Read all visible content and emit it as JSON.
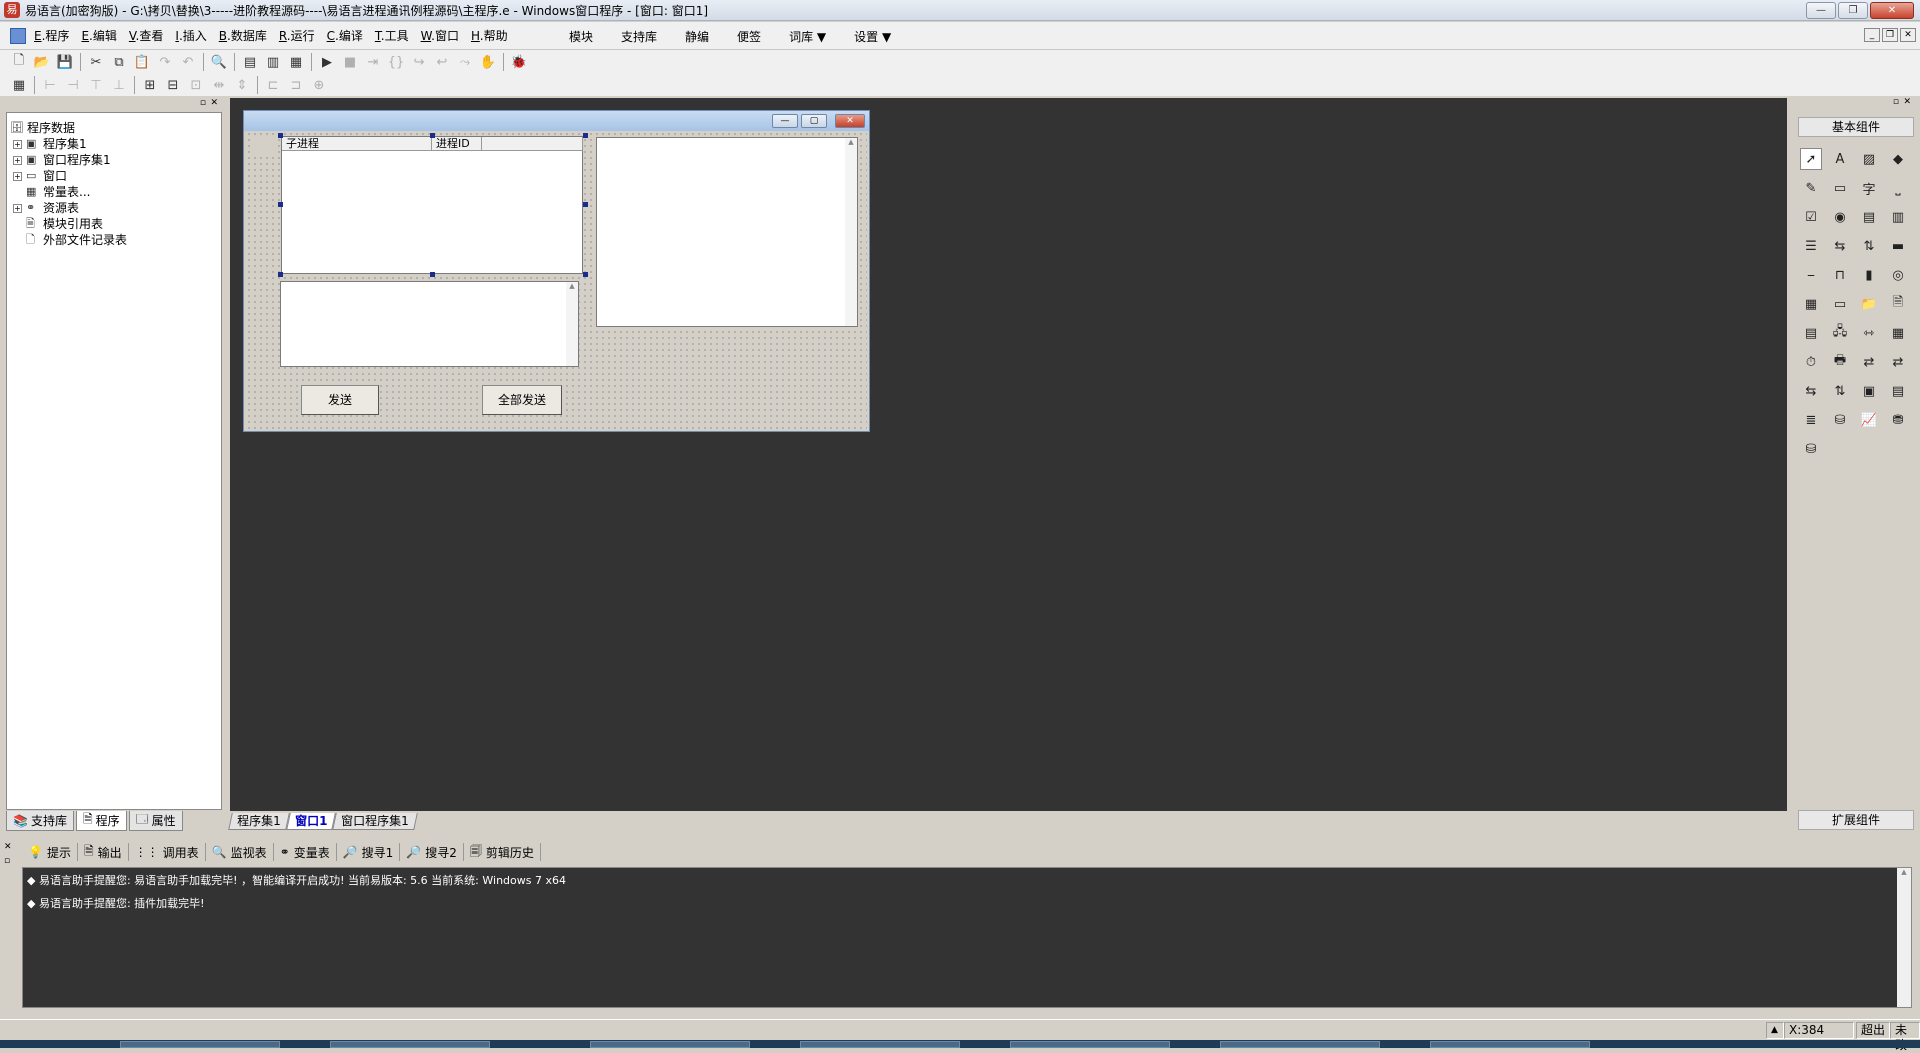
{
  "window": {
    "title": "易语言(加密狗版) - G:\\拷贝\\替换\\3-----进阶教程源码----\\易语言进程通讯例程源码\\主程序.e - Windows窗口程序 - [窗口: 窗口1]"
  },
  "menu": {
    "items": [
      {
        "key": "E",
        "label": "程序"
      },
      {
        "key": "E",
        "label": "编辑"
      },
      {
        "key": "V",
        "label": "查看"
      },
      {
        "key": "I",
        "label": "插入"
      },
      {
        "key": "B",
        "label": "数据库"
      },
      {
        "key": "R",
        "label": "运行"
      },
      {
        "key": "C",
        "label": "编译"
      },
      {
        "key": "T",
        "label": "工具"
      },
      {
        "key": "W",
        "label": "窗口"
      },
      {
        "key": "H",
        "label": "帮助"
      }
    ],
    "extra": [
      "模块",
      "支持库",
      "静编",
      "便签",
      "词库",
      "设置"
    ]
  },
  "tree": {
    "root": "程序数据",
    "items": [
      {
        "label": "程序集1",
        "exp": "+"
      },
      {
        "label": "窗口程序集1",
        "exp": "+"
      },
      {
        "label": "窗口",
        "exp": "+"
      },
      {
        "label": "常量表...",
        "exp": ""
      },
      {
        "label": "资源表",
        "exp": "+"
      },
      {
        "label": "模块引用表",
        "exp": ""
      },
      {
        "label": "外部文件记录表",
        "exp": ""
      }
    ]
  },
  "left_tabs": [
    "支持库",
    "程序",
    "属性"
  ],
  "form": {
    "listview_cols": [
      "子进程",
      "进程ID"
    ],
    "send_button": "发送",
    "send_all_button": "全部发送"
  },
  "right_panel": {
    "header": "基本组件",
    "footer": "扩展组件"
  },
  "doc_tabs": [
    "程序集1",
    "窗口1",
    "窗口程序集1"
  ],
  "output_tabs": [
    "提示",
    "输出",
    "调用表",
    "监视表",
    "变量表",
    "搜寻1",
    "搜寻2",
    "剪辑历史"
  ],
  "output_lines": [
    "易语言助手提醒您: 易语言助手加载完毕! ，智能编译开启成功! 当前易版本: 5.6 当前系统: Windows 7 x64",
    "易语言助手提醒您: 插件加载完毕!"
  ],
  "status": {
    "coord": "X:384",
    "mode": "超出",
    "changed": "未改"
  }
}
